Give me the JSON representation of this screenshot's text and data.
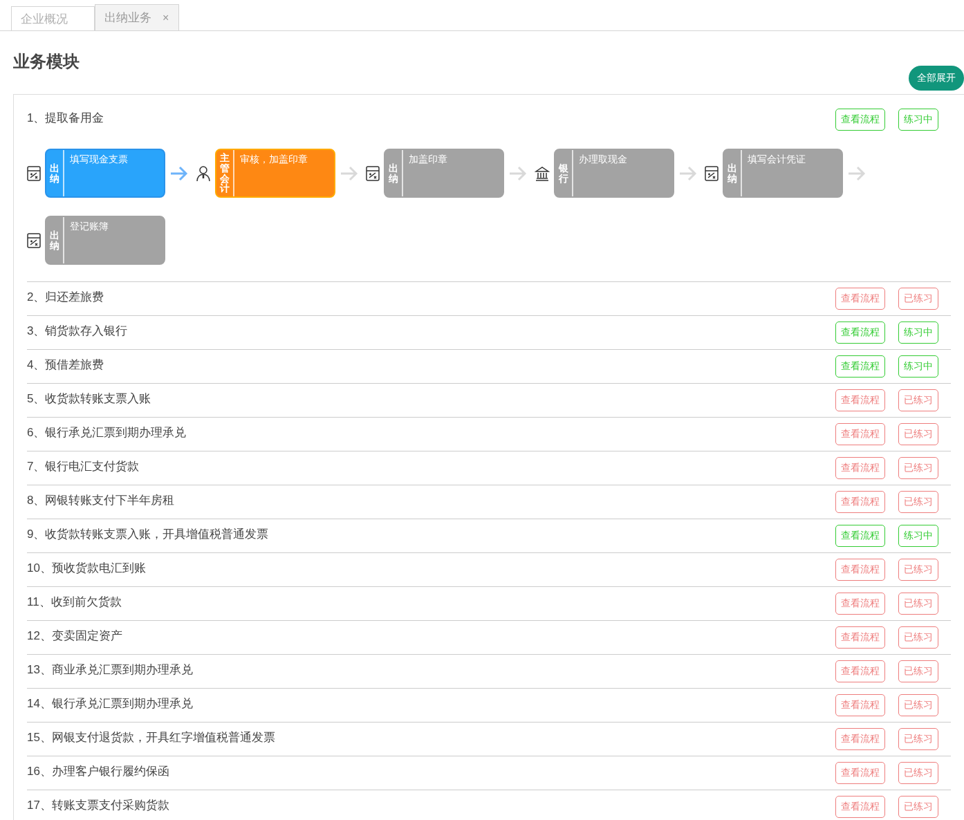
{
  "tabs": [
    {
      "label": "企业概况",
      "selected": false
    },
    {
      "label": "出纳业务",
      "selected": true,
      "close_glyph": "×"
    }
  ],
  "heading": "业务模块",
  "expand_all_button": "全部展开",
  "modules": [
    {
      "title": "1、提取备用金",
      "completed": false,
      "flow_button": "查看流程",
      "status_button": "练习中",
      "steps": [
        {
          "kind": "calculator",
          "role": "出纳",
          "text": "填写现金支票",
          "done": true,
          "current": false
        },
        {
          "kind": "person",
          "role": "主管会计",
          "text": "审核，加盖印章",
          "done": false,
          "current": true
        },
        {
          "kind": "calculator",
          "role": "出纳",
          "text": "加盖印章",
          "done": false,
          "current": false
        },
        {
          "kind": "bank",
          "role": "银行",
          "text": "办理取现金",
          "done": false,
          "current": false
        },
        {
          "kind": "calculator",
          "role": "出纳",
          "text": "填写会计凭证",
          "done": false,
          "current": false
        },
        {
          "kind": "calculator",
          "role": "出纳",
          "text": "登记账簿",
          "done": false,
          "current": false
        }
      ]
    },
    {
      "title": "2、归还差旅费",
      "completed": true,
      "flow_button": "查看流程",
      "status_button": "已练习"
    },
    {
      "title": "3、销货款存入银行",
      "completed": false,
      "flow_button": "查看流程",
      "status_button": "练习中"
    },
    {
      "title": "4、预借差旅费",
      "completed": false,
      "flow_button": "查看流程",
      "status_button": "练习中"
    },
    {
      "title": "5、收货款转账支票入账",
      "completed": true,
      "flow_button": "查看流程",
      "status_button": "已练习"
    },
    {
      "title": "6、银行承兑汇票到期办理承兑",
      "completed": true,
      "flow_button": "查看流程",
      "status_button": "已练习"
    },
    {
      "title": "7、银行电汇支付货款",
      "completed": true,
      "flow_button": "查看流程",
      "status_button": "已练习"
    },
    {
      "title": "8、网银转账支付下半年房租",
      "completed": true,
      "flow_button": "查看流程",
      "status_button": "已练习"
    },
    {
      "title": "9、收货款转账支票入账，开具增值税普通发票",
      "completed": false,
      "flow_button": "查看流程",
      "status_button": "练习中"
    },
    {
      "title": "10、预收货款电汇到账",
      "completed": true,
      "flow_button": "查看流程",
      "status_button": "已练习"
    },
    {
      "title": "11、收到前欠货款",
      "completed": true,
      "flow_button": "查看流程",
      "status_button": "已练习"
    },
    {
      "title": "12、变卖固定资产",
      "completed": true,
      "flow_button": "查看流程",
      "status_button": "已练习"
    },
    {
      "title": "13、商业承兑汇票到期办理承兑",
      "completed": true,
      "flow_button": "查看流程",
      "status_button": "已练习"
    },
    {
      "title": "14、银行承兑汇票到期办理承兑",
      "completed": true,
      "flow_button": "查看流程",
      "status_button": "已练习"
    },
    {
      "title": "15、网银支付退货款，开具红字增值税普通发票",
      "completed": true,
      "flow_button": "查看流程",
      "status_button": "已练习"
    },
    {
      "title": "16、办理客户银行履约保函",
      "completed": true,
      "flow_button": "查看流程",
      "status_button": "已练习"
    },
    {
      "title": "17、转账支票支付采购货款",
      "completed": true,
      "flow_button": "查看流程",
      "status_button": "已练习"
    }
  ]
}
